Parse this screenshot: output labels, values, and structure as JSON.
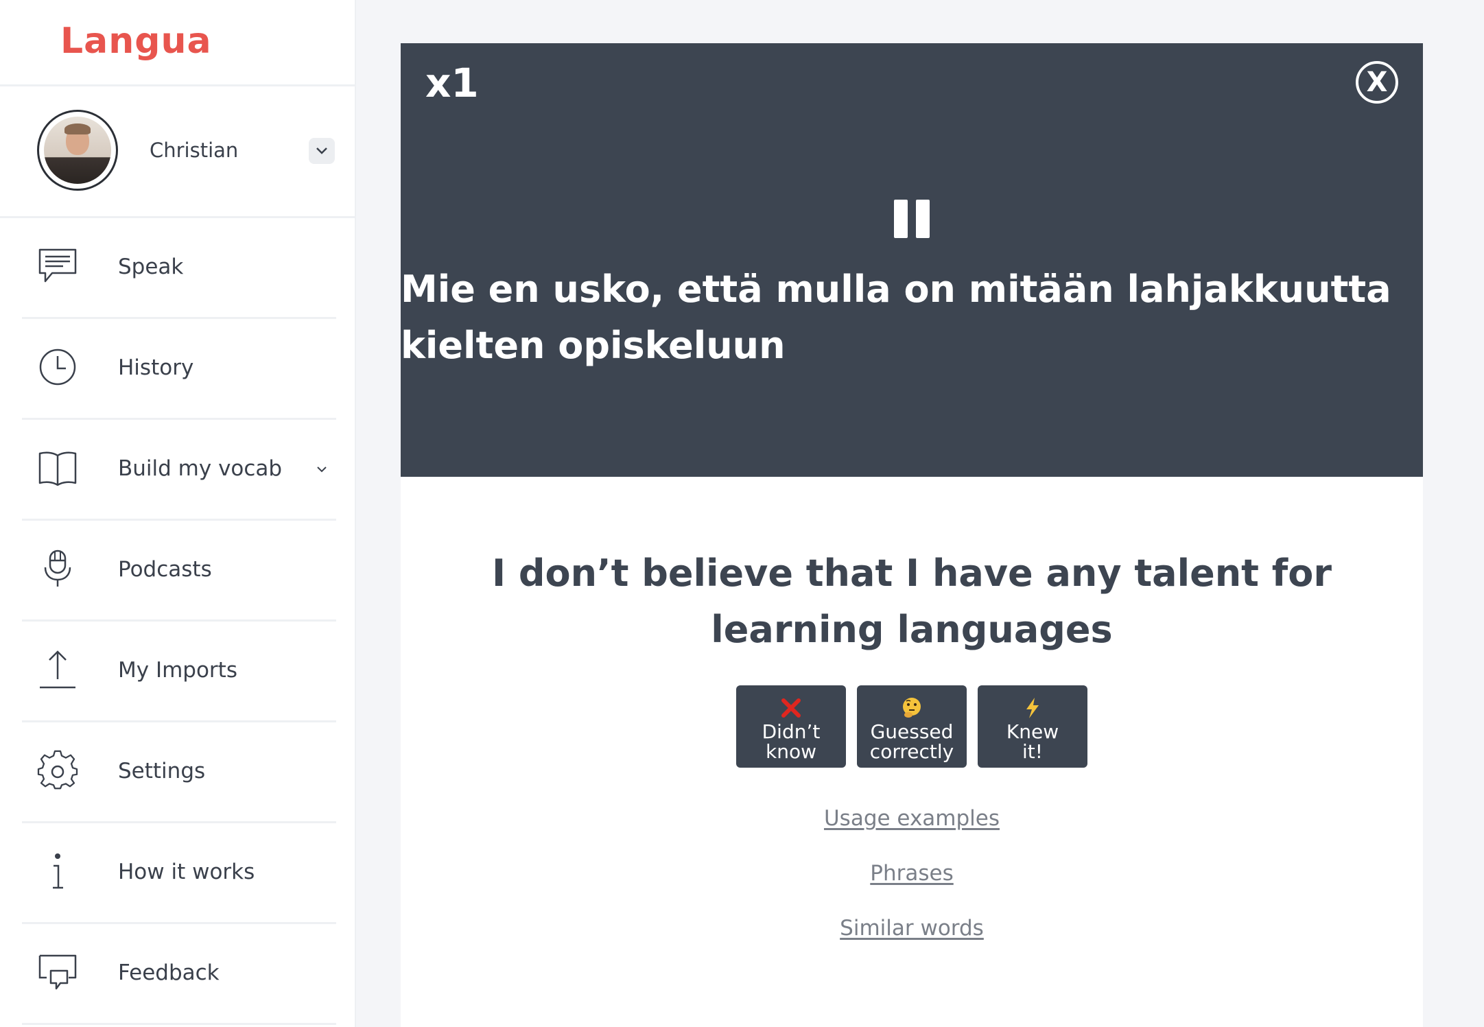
{
  "app": {
    "logo_text": "Langua",
    "brand_color": "#e8554e"
  },
  "user": {
    "name": "Christian"
  },
  "nav": {
    "items": [
      {
        "label": "Speak",
        "icon": "chat-bubble-icon"
      },
      {
        "label": "History",
        "icon": "clock-icon"
      },
      {
        "label": "Build my vocab",
        "icon": "open-book-icon",
        "has_submenu": true
      },
      {
        "label": "Podcasts",
        "icon": "microphone-icon"
      },
      {
        "label": "My Imports",
        "icon": "upload-icon"
      },
      {
        "label": "Settings",
        "icon": "gear-icon"
      },
      {
        "label": "How it works",
        "icon": "info-icon"
      },
      {
        "label": "Feedback",
        "icon": "feedback-icon"
      }
    ]
  },
  "flashcard": {
    "multiplier": "x1",
    "close_label": "X",
    "phrase": "Mie en usko, että mulla on mitään lahjakkuutta kielten opiskeluun",
    "translation": "I don’t believe that I have any talent for learning languages",
    "rating_buttons": [
      {
        "label_line1": "Didn’t",
        "label_line2": "know",
        "icon": "red-cross-icon"
      },
      {
        "label_line1": "Guessed",
        "label_line2": "correctly",
        "icon": "thinking-face-icon"
      },
      {
        "label_line1": "Knew",
        "label_line2": "it!",
        "icon": "lightning-icon"
      }
    ],
    "links": {
      "usage_examples": "Usage examples",
      "phrases": "Phrases",
      "similar_words": "Similar words"
    }
  },
  "colors": {
    "card_dark": "#3d4551",
    "page_background": "#f4f5f8",
    "link_gray": "#7a7f88"
  }
}
